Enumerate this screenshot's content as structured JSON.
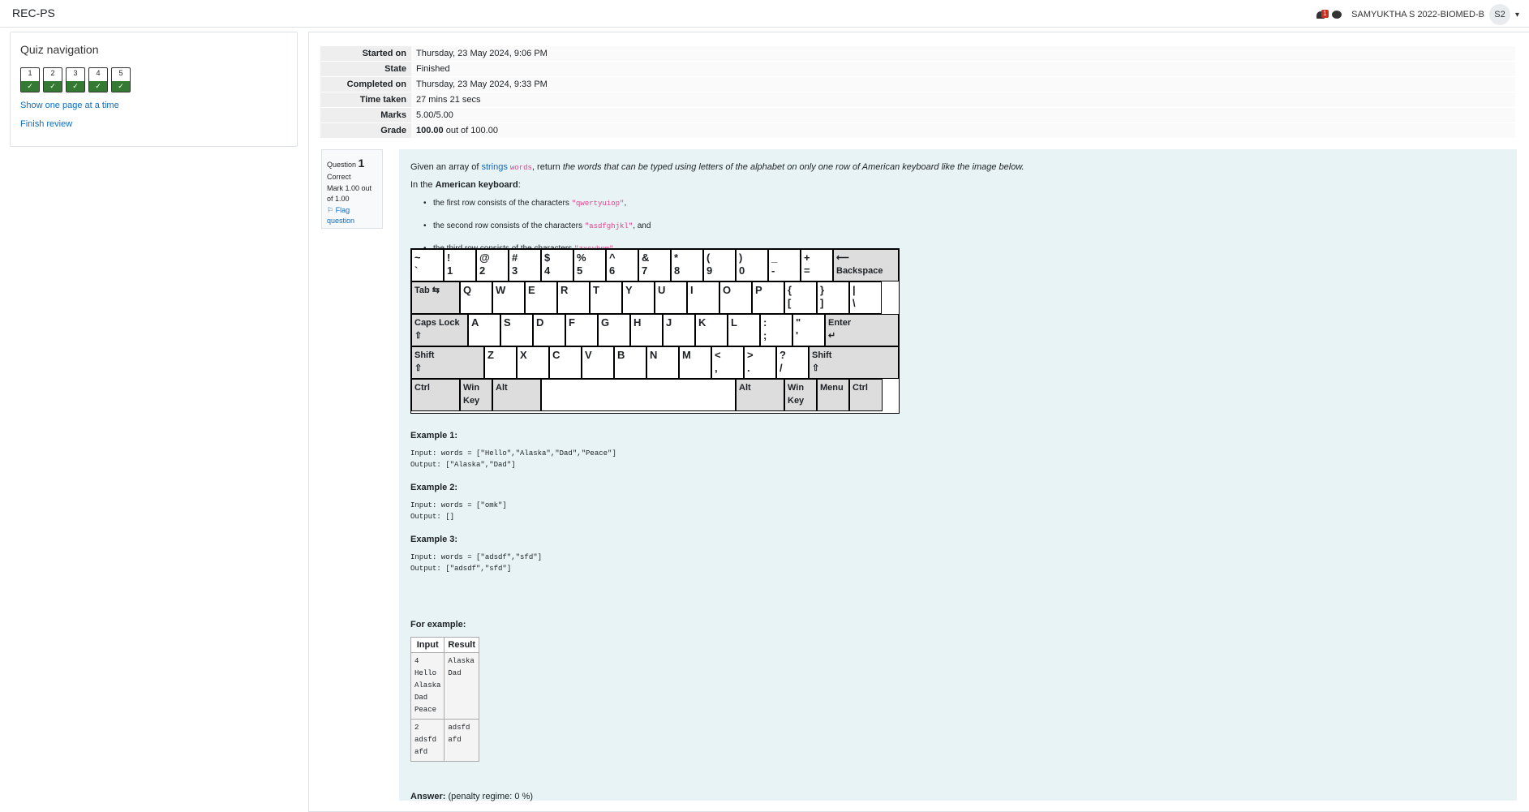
{
  "header": {
    "site_name": "REC-PS",
    "notif_count": "1",
    "user_name": "SAMYUKTHA S 2022-BIOMED-B",
    "avatar": "S2"
  },
  "nav": {
    "title": "Quiz navigation",
    "questions": [
      "1",
      "2",
      "3",
      "4",
      "5"
    ],
    "check": "✓",
    "show_one_page": "Show one page at a time",
    "finish_review": "Finish review"
  },
  "summary": [
    {
      "label": "Started on",
      "value": "Thursday, 23 May 2024, 9:06 PM"
    },
    {
      "label": "State",
      "value": "Finished"
    },
    {
      "label": "Completed on",
      "value": "Thursday, 23 May 2024, 9:33 PM"
    },
    {
      "label": "Time taken",
      "value": "27 mins 21 secs"
    },
    {
      "label": "Marks",
      "value": "5.00/5.00"
    },
    {
      "label": "Grade",
      "value_bold": "100.00",
      "value_rest": " out of 100.00"
    }
  ],
  "question": {
    "label": "Question",
    "number": "1",
    "status": "Correct",
    "mark": "Mark 1.00 out of 1.00",
    "flag": "Flag question"
  },
  "problem": {
    "p1_a": "Given an array of ",
    "p1_link": "strings",
    "p1_code": "words",
    "p1_b": ", return ",
    "p1_em": "the words that can be typed using letters of the alphabet on only one row of American keyboard like the image below.",
    "p2_a": "In the ",
    "p2_bold": "American keyboard",
    ":": ":",
    "b1_text": "the first row consists of the characters ",
    "b1_code": "\"qwertyuiop\"",
    "b1_end": ",",
    "b2_text": "the second row consists of the characters ",
    "b2_code": "\"asdfghjkl\"",
    "b2_end": ", and",
    "b3_text": "the third row consists of the characters ",
    "b3_code": "\"zxcvbnm\"",
    "b3_end": "."
  },
  "keyboard": {
    "row1": [
      "~\n`",
      "!\n1",
      "@\n2",
      "#\n3",
      "$\n4",
      "%\n5",
      "^\n6",
      "&\n7",
      "*\n8",
      "(\n9",
      ")\n0",
      "_\n-",
      "+\n="
    ],
    "backspace": "⟵\nBackspace",
    "tab": "Tab ⇆",
    "row2": [
      "Q",
      "W",
      "E",
      "R",
      "T",
      "Y",
      "U",
      "I",
      "O",
      "P",
      "{\n[",
      "}\n]",
      "|\n\\"
    ],
    "caps": "Caps Lock\n⇧",
    "row3": [
      "A",
      "S",
      "D",
      "F",
      "G",
      "H",
      "J",
      "K",
      "L",
      ":\n;",
      "\"\n'"
    ],
    "enter": "Enter\n↵",
    "shift": "Shift\n⇧",
    "row4": [
      "Z",
      "X",
      "C",
      "V",
      "B",
      "N",
      "M",
      "<\n,",
      ">\n.",
      "?\n/"
    ],
    "row5_left": [
      "Ctrl",
      "Win\nKey",
      "Alt"
    ],
    "row5_right": [
      "Alt",
      "Win\nKey",
      "Menu",
      "Ctrl"
    ]
  },
  "examples": [
    {
      "title": "Example 1:",
      "input": "Input: words = [\"Hello\",\"Alaska\",\"Dad\",\"Peace\"]",
      "output": "Output: [\"Alaska\",\"Dad\"]"
    },
    {
      "title": "Example 2:",
      "input": "Input: words = [\"omk\"]",
      "output": "Output: []"
    },
    {
      "title": "Example 3:",
      "input": "Input: words = [\"adsdf\",\"sfd\"]",
      "output": "Output: [\"adsdf\",\"sfd\"]"
    }
  ],
  "for_example": {
    "title": "For example:",
    "headers": [
      "Input",
      "Result"
    ],
    "rows": [
      {
        "input": "4\nHello\nAlaska\nDad\nPeace",
        "result": "Alaska\nDad"
      },
      {
        "input": "2\nadsfd\nafd",
        "result": "adsfd\nafd"
      }
    ]
  },
  "answer": {
    "label": "Answer:",
    "penalty": "(penalty regime: 0 %)"
  }
}
